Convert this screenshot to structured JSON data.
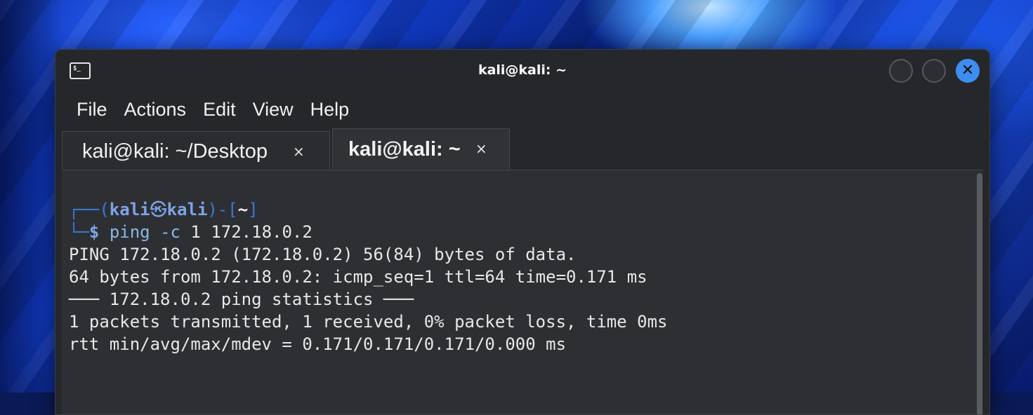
{
  "window": {
    "title": "kali@kali: ~",
    "icon_text": "$_"
  },
  "menu": {
    "items": [
      "File",
      "Actions",
      "Edit",
      "View",
      "Help"
    ]
  },
  "tabs": [
    {
      "label": "kali@kali: ~/Desktop",
      "close": "×",
      "active": false
    },
    {
      "label": "kali@kali: ~",
      "close": "×",
      "active": true
    }
  ],
  "terminal": {
    "prompt": {
      "top_prefix": "┌──(",
      "user": "kali",
      "at_symbol": "㉿",
      "host": "kali",
      "mid": ")-[",
      "path": "~",
      "end": "]",
      "bottom_prefix": "└─",
      "dollar": "$"
    },
    "command": {
      "name": "ping",
      "flag": "-c",
      "args": "1 172.18.0.2"
    },
    "output": [
      "PING 172.18.0.2 (172.18.0.2) 56(84) bytes of data.",
      "64 bytes from 172.18.0.2: icmp_seq=1 ttl=64 time=0.171 ms",
      "",
      "─── 172.18.0.2 ping statistics ───",
      "1 packets transmitted, 1 received, 0% packet loss, time 0ms",
      "rtt min/avg/max/mdev = 0.171/0.171/0.171/0.000 ms"
    ]
  },
  "colors": {
    "close_button": "#3d8ef0",
    "prompt_blue": "#3b78d8",
    "command_blue": "#8ab8e8"
  }
}
